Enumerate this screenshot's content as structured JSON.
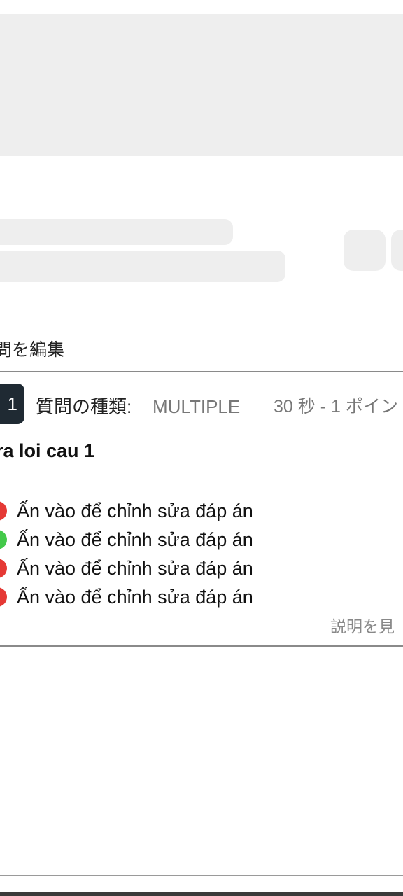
{
  "editor": {
    "edit_questions_label": "問を編集"
  },
  "question": {
    "number": "1",
    "type_label": "質問の種類:",
    "type_value": "MULTIPLE",
    "meta": "30 秒 - 1 ポイン",
    "text": "ra loi cau 1",
    "answers": [
      {
        "text": "Ấn vào để chỉnh sửa đáp án",
        "color": "#e53935",
        "correct": false
      },
      {
        "text": "Ấn vào để chỉnh sửa đáp án",
        "color": "#43c94a",
        "correct": true
      },
      {
        "text": "Ấn vào để chỉnh sửa đáp án",
        "color": "#e53935",
        "correct": false
      },
      {
        "text": "Ấn vào để chỉnh sửa đáp án",
        "color": "#e53935",
        "correct": false
      }
    ],
    "view_explanation_label": "説明を見"
  },
  "colors": {
    "correct": "#43c94a",
    "incorrect": "#e53935",
    "badge": "#1f2a33",
    "skeleton": "#eeeeee"
  }
}
